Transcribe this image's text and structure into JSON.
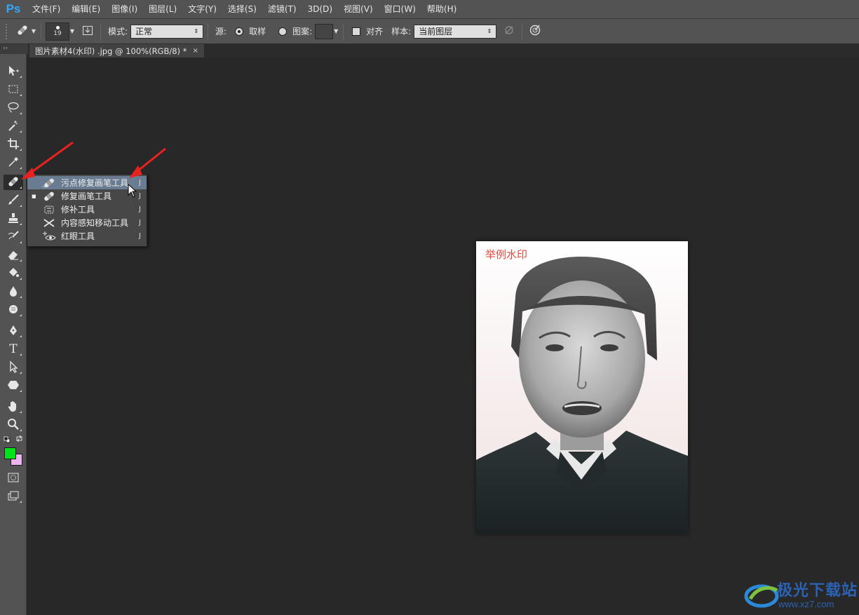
{
  "app": {
    "logo": "Ps"
  },
  "menu": [
    "文件(F)",
    "编辑(E)",
    "图像(I)",
    "图层(L)",
    "文字(Y)",
    "选择(S)",
    "滤镜(T)",
    "3D(D)",
    "视图(V)",
    "窗口(W)",
    "帮助(H)"
  ],
  "options": {
    "brush_size": "19",
    "mode_label": "模式:",
    "mode_value": "正常",
    "source_label": "源:",
    "sampled_label": "取样",
    "pattern_label": "图案:",
    "aligned_label": "对齐",
    "sample_label": "样本:",
    "sample_value": "当前图层"
  },
  "document": {
    "tab_title": "图片素材4(水印) .jpg @ 100%(RGB/8) *",
    "close_symbol": "×",
    "watermark_text": "举例水印"
  },
  "colors": {
    "foreground": "#00e21a",
    "background": "#ecb4ec",
    "arrow": "#e8231f",
    "highlight": "#6a7c92"
  },
  "flyout": {
    "items": [
      {
        "label": "污点修复画笔工具",
        "key": "J",
        "icon": "spot-healing-brush-icon",
        "selected": false,
        "highlighted": true
      },
      {
        "label": "修复画笔工具",
        "key": "J",
        "icon": "healing-brush-icon",
        "selected": true,
        "highlighted": false
      },
      {
        "label": "修补工具",
        "key": "J",
        "icon": "patch-icon",
        "selected": false,
        "highlighted": false
      },
      {
        "label": "内容感知移动工具",
        "key": "J",
        "icon": "content-aware-move-icon",
        "selected": false,
        "highlighted": false
      },
      {
        "label": "红眼工具",
        "key": "J",
        "icon": "red-eye-icon",
        "selected": false,
        "highlighted": false
      }
    ]
  },
  "tools": [
    "move-tool-icon",
    "marquee-tool-icon",
    "lasso-tool-icon",
    "magic-wand-icon",
    "crop-tool-icon",
    "eyedropper-icon",
    "healing-brush-icon",
    "brush-tool-icon",
    "clone-stamp-icon",
    "history-brush-icon",
    "eraser-icon",
    "paint-bucket-icon",
    "blur-tool-icon",
    "dodge-tool-icon",
    "pen-tool-icon",
    "type-tool-icon",
    "path-selection-icon",
    "shape-tool-icon",
    "hand-tool-icon",
    "zoom-tool-icon"
  ],
  "site_logo": {
    "name": "极光下载站",
    "url": "www.xz7.com"
  }
}
